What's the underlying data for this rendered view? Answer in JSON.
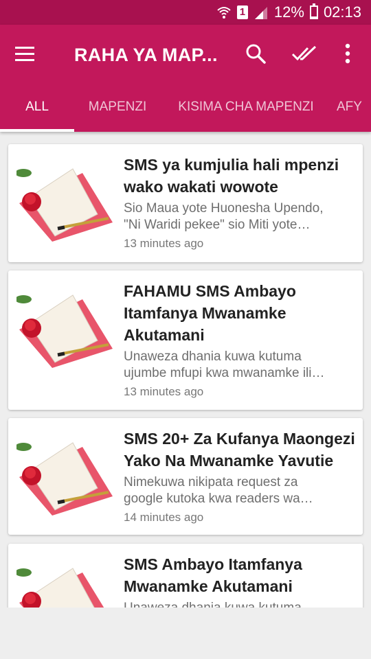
{
  "status_bar": {
    "sim_label": "1",
    "battery": "12%",
    "time": "02:13"
  },
  "app_bar": {
    "title": "RAHA YA MAP...",
    "menu_icon": "hamburger-menu-icon",
    "search_icon": "search-icon",
    "mark_read_icon": "double-check-icon",
    "more_icon": "more-vert-icon"
  },
  "tabs": [
    {
      "label": "ALL",
      "active": true
    },
    {
      "label": "MAPENZI"
    },
    {
      "label": "KISIMA CHA MAPENZI"
    },
    {
      "label": "AFY"
    }
  ],
  "colors": {
    "primary": "#c2185b",
    "status_bar": "#a8114f",
    "background": "#eeeeee"
  },
  "articles": [
    {
      "title_lines": [
        "SMS ya kumjulia hali mpenzi",
        "wako wakati wowote"
      ],
      "excerpt_lines": [
        "Sio Maua yote Huonesha Upendo,",
        "\"Ni Waridi pekee\" sio Miti yote…"
      ],
      "time": "13 minutes ago",
      "thumbnail": "rose-envelope-pen-image"
    },
    {
      "title_lines": [
        "FAHAMU SMS Ambayo",
        "Itamfanya Mwanamke",
        "Akutamani"
      ],
      "excerpt_lines": [
        "Unaweza dhania kuwa kutuma",
        "ujumbe mfupi kwa mwanamke ili…"
      ],
      "time": "13 minutes ago",
      "thumbnail": "rose-envelope-pen-image"
    },
    {
      "title_lines": [
        "SMS 20+ Za Kufanya Maongezi",
        "Yako Na Mwanamke Yavutie"
      ],
      "excerpt_lines": [
        "Nimekuwa nikipata request za",
        "google kutoka kwa readers wa…"
      ],
      "time": "14 minutes ago",
      "thumbnail": "rose-envelope-pen-image"
    },
    {
      "title_lines": [
        "SMS Ambayo Itamfanya",
        "Mwanamke Akutamani"
      ],
      "excerpt_lines": [
        "Unaweza dhania kuwa kutuma"
      ],
      "time": "",
      "thumbnail": "rose-envelope-pen-image"
    }
  ]
}
